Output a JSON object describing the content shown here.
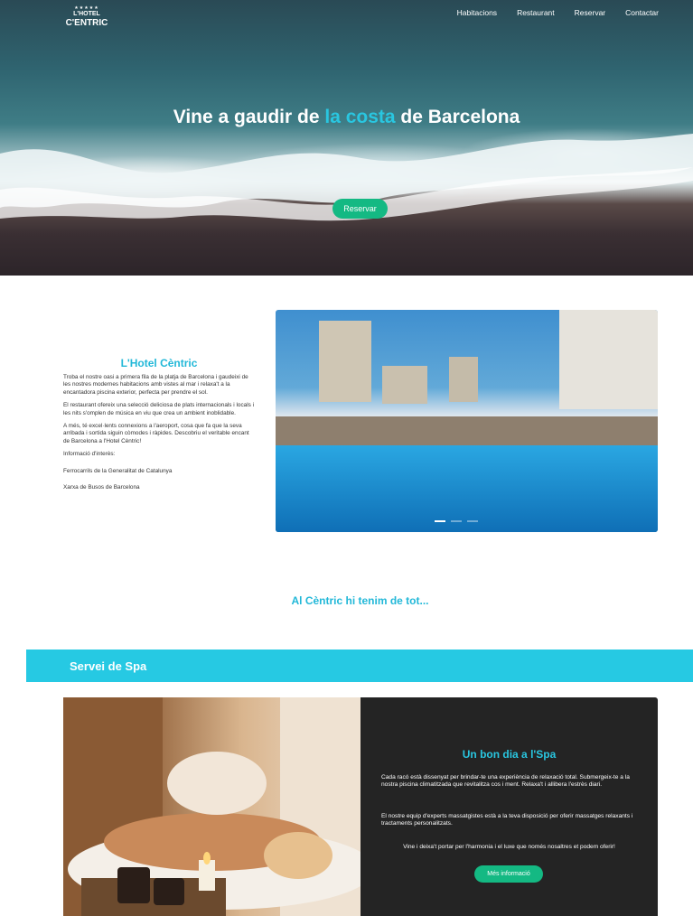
{
  "header": {
    "logo": {
      "stars": "★★★★★",
      "line1": "L'HOTEL",
      "line2": "C'ENTRIC"
    },
    "nav": [
      "Habitacions",
      "Restaurant",
      "Reservar",
      "Contactar"
    ]
  },
  "hero": {
    "title_pre": "Vine a gaudir de ",
    "title_accent": "la costa",
    "title_post": " de Barcelona",
    "button": "Reservar"
  },
  "about": {
    "title": "L'Hotel Cèntric",
    "paragraphs": [
      "Troba el nostre oasi a primera fila de la platja de Barcelona i gaudeixi de les nostres modernes habitacions amb vistes al mar i relaxa't a la encantadora piscina exterior, perfecta per prendre el sol.",
      "El restaurant ofereix una selecció deliciosa de plats internacionals i locals i les nits s'omplen de música en viu que crea un ambient inoblidable.",
      "A més, té excel·lents connexions a l'aeroport, cosa que fa que la seva arribada i sortida siguin còmodes i ràpides. Descobriu el veritable encant de Barcelona a l'Hotel Cèntric!",
      "Informació d'interès:",
      "Ferrocarrils de la Generalitat de Catalunya",
      "Xarxa de Busos de Barcelona"
    ]
  },
  "carousel": {
    "slides": 3,
    "active": 0
  },
  "tagline": "Al Cèntric hi tenim de tot...",
  "spa": {
    "banner": "Servei de Spa",
    "card_title": "Un bon dia a l'Spa",
    "p1": "Cada racó està dissenyat per brindar-te una experiència de relaxació total. Submergeix-te a la nostra piscina climatitzada que revitalitza cos i ment. Relaxa't i allibera l'estrès diari.",
    "p2": "El nostre equip d'experts massatgistes està a la teva disposició per oferir massatges relaxants i tractaments personalitzats.",
    "p3": "Vine i deixa't portar per l'harmonia i el luxe que només nosaltres et podem oferir!",
    "button": "Més informació"
  },
  "colors": {
    "accent": "#29c6e0",
    "button": "#14b983",
    "card_bg": "#242424"
  }
}
